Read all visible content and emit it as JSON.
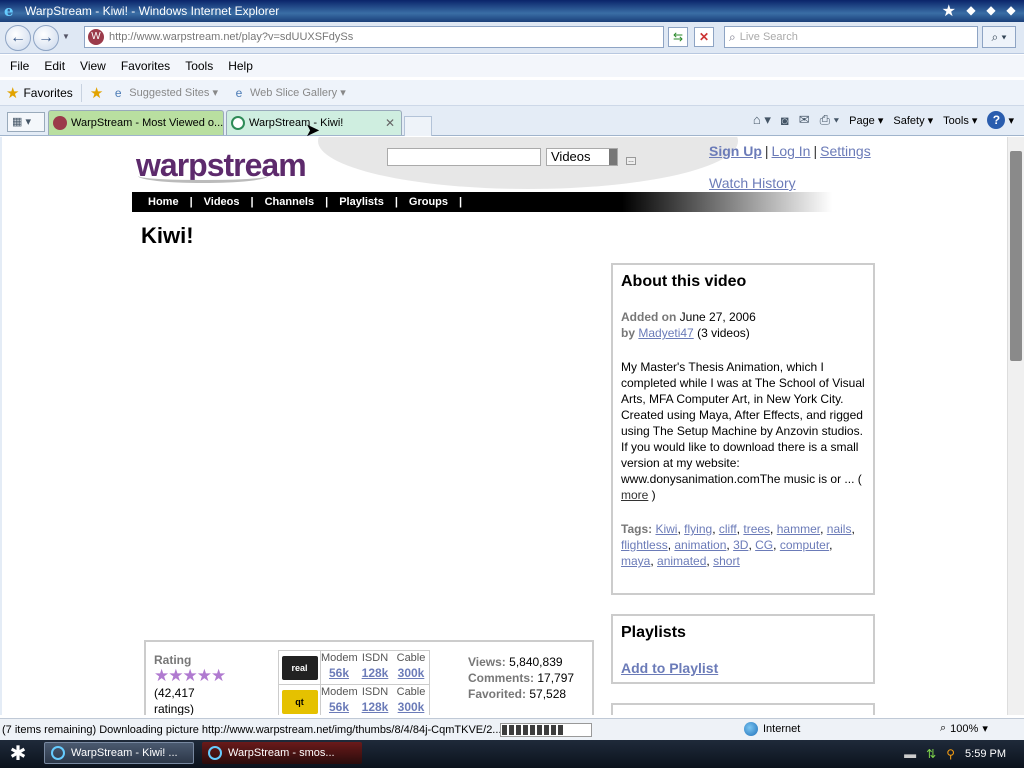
{
  "window": {
    "title": "WarpStream - Kiwi! - Windows Internet Explorer"
  },
  "address_bar": {
    "url": "http://www.warpstream.net/play?v=sdUUXSFdySs",
    "search_placeholder": "Live Search"
  },
  "menu": [
    "File",
    "Edit",
    "View",
    "Favorites",
    "Tools",
    "Help"
  ],
  "favorites_bar": {
    "favorites_label": "Favorites",
    "links": [
      "Suggested Sites",
      "Web Slice Gallery"
    ]
  },
  "tabs": [
    {
      "label": "WarpStream - Most Viewed o...",
      "active": false
    },
    {
      "label": "WarpStream - Kiwi!",
      "active": true
    }
  ],
  "command_bar": {
    "page_label": "Page",
    "safety_label": "Safety",
    "tools_label": "Tools"
  },
  "site": {
    "logo": "warpstream",
    "search_category": "Videos",
    "signup": "Sign Up",
    "login": "Log In",
    "settings": "Settings",
    "watch_history": "Watch History",
    "nav": [
      "Home",
      "Videos",
      "Channels",
      "Playlists",
      "Groups"
    ]
  },
  "video": {
    "title": "Kiwi!"
  },
  "about": {
    "heading": "About this video",
    "added_label": "Added on",
    "added_date": "June 27, 2006",
    "by_label": "by",
    "author": "Madyeti47",
    "author_videos": "(3 videos)",
    "description": "My Master's Thesis Animation, which I completed while I was at The School of Visual Arts, MFA Computer Art, in New York City. Created using Maya, After Effects, and rigged using The Setup Machine by Anzovin studios. If you would like to download there is a small version at my website: www.donysanimation.comThe music is or ...",
    "more_label": "more",
    "tags_label": "Tags:",
    "tags": [
      "Kiwi",
      "flying",
      "cliff",
      "trees",
      "hammer",
      "nails",
      "flightless",
      "animation",
      "3D",
      "CG",
      "computer",
      "maya",
      "animated",
      "short"
    ]
  },
  "playlists": {
    "heading": "Playlists",
    "add_label": "Add to Playlist"
  },
  "stats": {
    "rating_label": "Rating",
    "rating_stars": 5,
    "ratings_count": "(42,417",
    "ratings_word": "ratings)",
    "download_rows": [
      {
        "format": "real",
        "speeds": [
          {
            "label": "Modem",
            "value": "56k"
          },
          {
            "label": "ISDN",
            "value": "128k"
          },
          {
            "label": "Cable",
            "value": "300k"
          }
        ]
      },
      {
        "format": "qt",
        "speeds": [
          {
            "label": "Modem",
            "value": "56k"
          },
          {
            "label": "ISDN",
            "value": "128k"
          },
          {
            "label": "Cable",
            "value": "300k"
          }
        ]
      }
    ],
    "views_label": "Views:",
    "views": "5,840,839",
    "comments_label": "Comments:",
    "comments": "17,797",
    "favorited_label": "Favorited:",
    "favorited": "57,528"
  },
  "status_bar": {
    "text": "(7 items remaining) Downloading picture http://www.warpstream.net/img/thumbs/8/4/84j-CqmTKVE/2...",
    "progress": 0.7,
    "zone": "Internet",
    "zoom": "100%"
  },
  "taskbar": {
    "tasks": [
      "WarpStream - Kiwi! ...",
      "WarpStream - smos..."
    ],
    "clock": "5:59 PM"
  }
}
